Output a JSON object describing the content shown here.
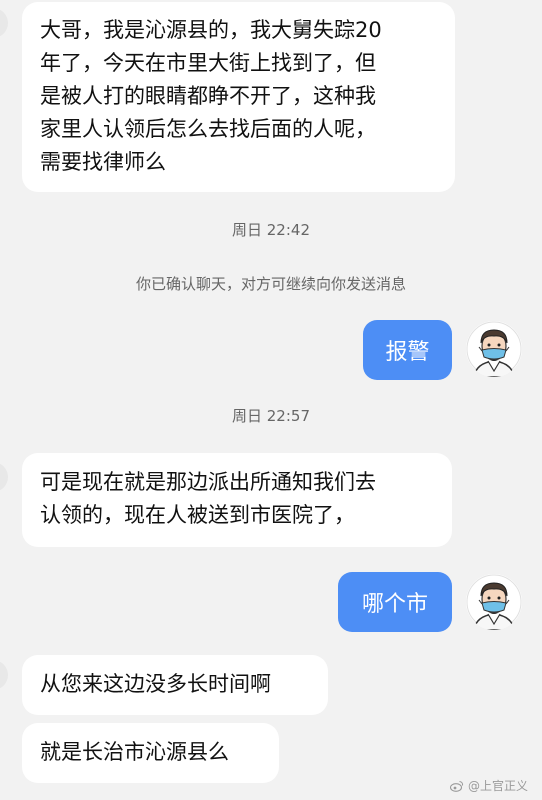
{
  "messages": {
    "m1": [
      "大哥，我是沁源县的，我大舅失踪20",
      "年了，今天在市里大街上找到了，但",
      "是被人打的眼睛都睁不开了，这种我",
      "家里人认领后怎么去找后面的人呢，",
      "需要找律师么"
    ],
    "time1": "周日 22:42",
    "notice": "你已确认聊天，对方可继续向你发送消息",
    "out1": "报警",
    "time2": "周日 22:57",
    "m2": [
      "可是现在就是那边派出所通知我们去",
      "认领的，现在人被送到市医院了，"
    ],
    "out2": "哪个市",
    "m3": "从您来这边没多长时间啊",
    "m4": "就是长治市沁源县么"
  },
  "watermark": "@上官正义",
  "colors": {
    "background": "#f2f2f2",
    "incoming_bubble": "#ffffff",
    "outgoing_bubble": "#4d8ef5",
    "meta_text": "#666666"
  },
  "icons": {
    "avatar": "avatar-masked-man-icon",
    "watermark": "weibo-logo-icon"
  }
}
